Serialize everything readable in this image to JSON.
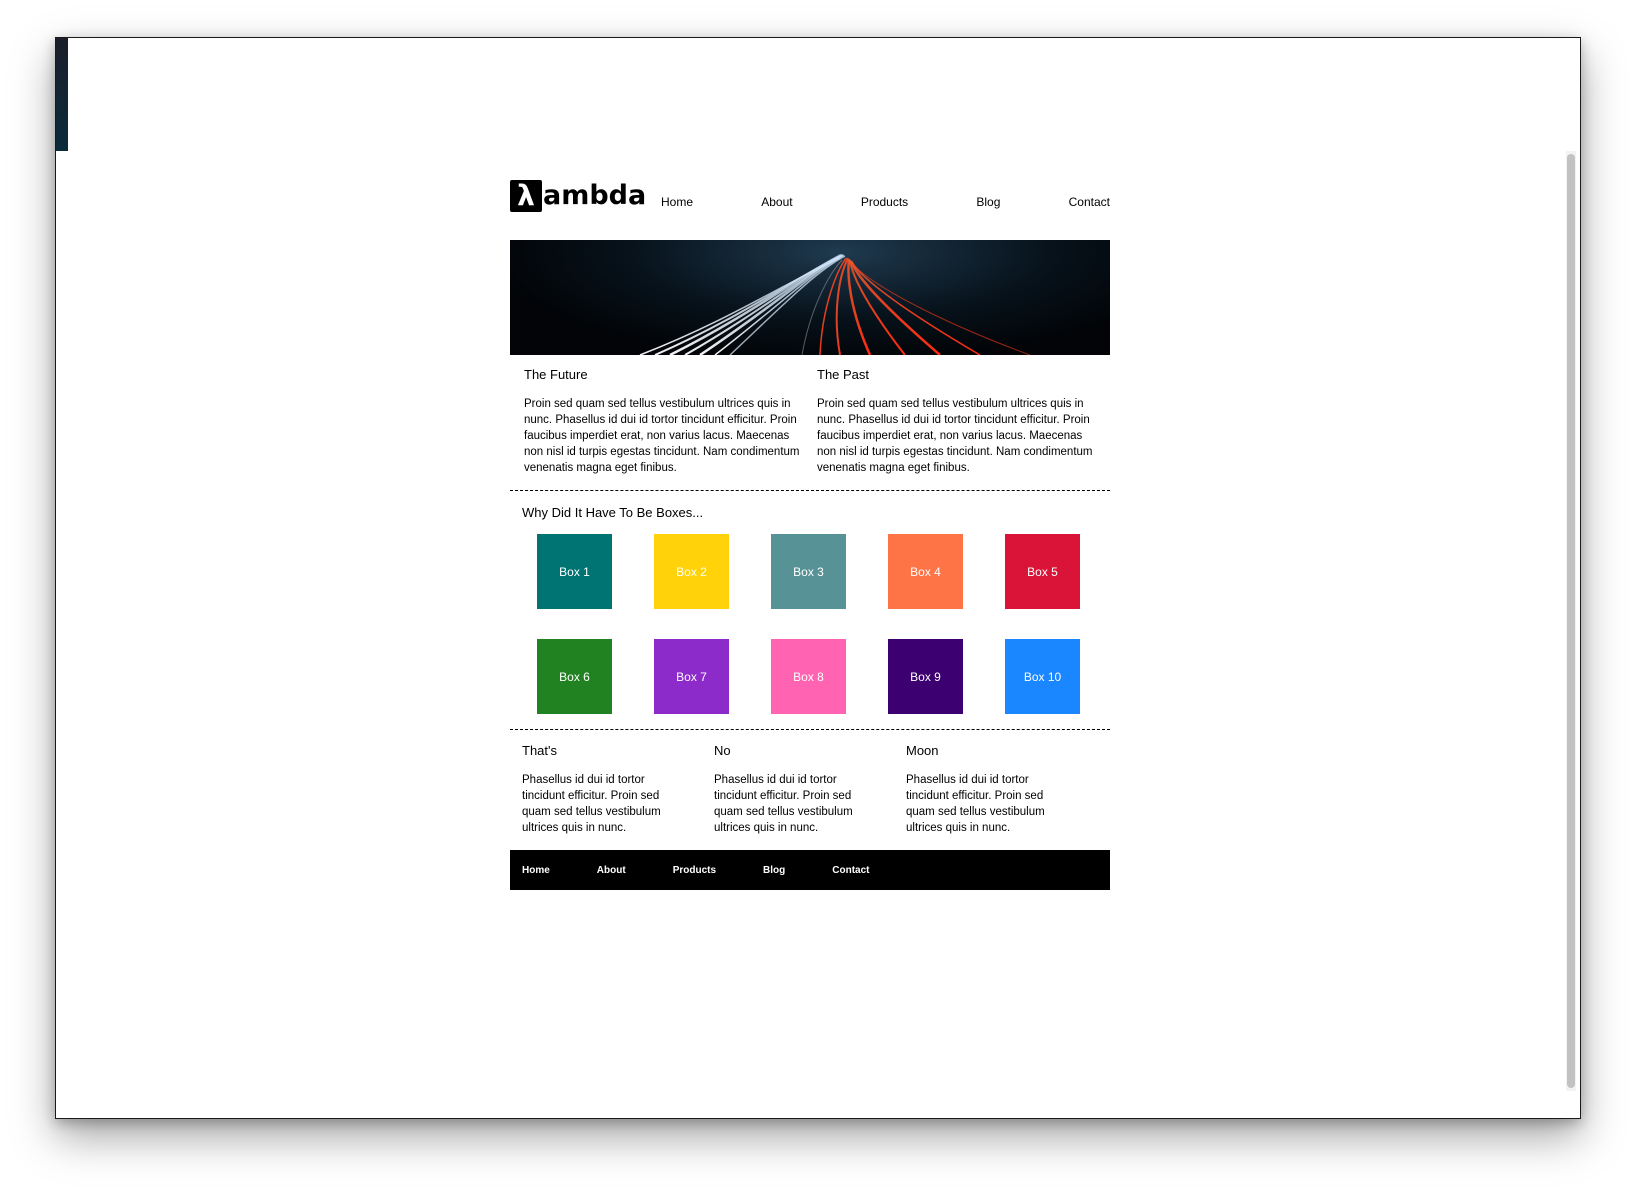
{
  "logo": {
    "symbol": "λ",
    "text": "ambda"
  },
  "nav": [
    "Home",
    "About",
    "Products",
    "Blog",
    "Contact"
  ],
  "intro": [
    {
      "title": "The Future",
      "body": "Proin sed quam sed tellus vestibulum ultrices quis in nunc. Phasellus id dui id tortor tincidunt efficitur. Proin faucibus imperdiet erat, non varius lacus. Maecenas non nisl id turpis egestas tincidunt. Nam condimentum venenatis magna eget finibus."
    },
    {
      "title": "The Past",
      "body": "Proin sed quam sed tellus vestibulum ultrices quis in nunc. Phasellus id dui id tortor tincidunt efficitur. Proin faucibus imperdiet erat, non varius lacus. Maecenas non nisl id turpis egestas tincidunt. Nam condimentum venenatis magna eget finibus."
    }
  ],
  "boxes_title": "Why Did It Have To Be Boxes...",
  "boxes": [
    {
      "label": "Box 1",
      "color": "#007373"
    },
    {
      "label": "Box 2",
      "color": "#ffd20a"
    },
    {
      "label": "Box 3",
      "color": "#579396"
    },
    {
      "label": "Box 4",
      "color": "#ff7447"
    },
    {
      "label": "Box 5",
      "color": "#da1339"
    },
    {
      "label": "Box 6",
      "color": "#208220"
    },
    {
      "label": "Box 7",
      "color": "#8c2bc9"
    },
    {
      "label": "Box 8",
      "color": "#ff63b1"
    },
    {
      "label": "Box 9",
      "color": "#3c0071"
    },
    {
      "label": "Box 10",
      "color": "#1a86ff"
    }
  ],
  "bottom": [
    {
      "title": "That's",
      "body": "Phasellus id dui id tortor tincidunt efficitur. Proin sed quam sed tellus vestibulum ultrices quis in nunc."
    },
    {
      "title": "No",
      "body": "Phasellus id dui id tortor tincidunt efficitur. Proin sed quam sed tellus vestibulum ultrices quis in nunc."
    },
    {
      "title": "Moon",
      "body": "Phasellus id dui id tortor tincidunt efficitur. Proin sed quam sed tellus vestibulum ultrices quis in nunc."
    }
  ],
  "footer_nav": [
    "Home",
    "About",
    "Products",
    "Blog",
    "Contact"
  ]
}
